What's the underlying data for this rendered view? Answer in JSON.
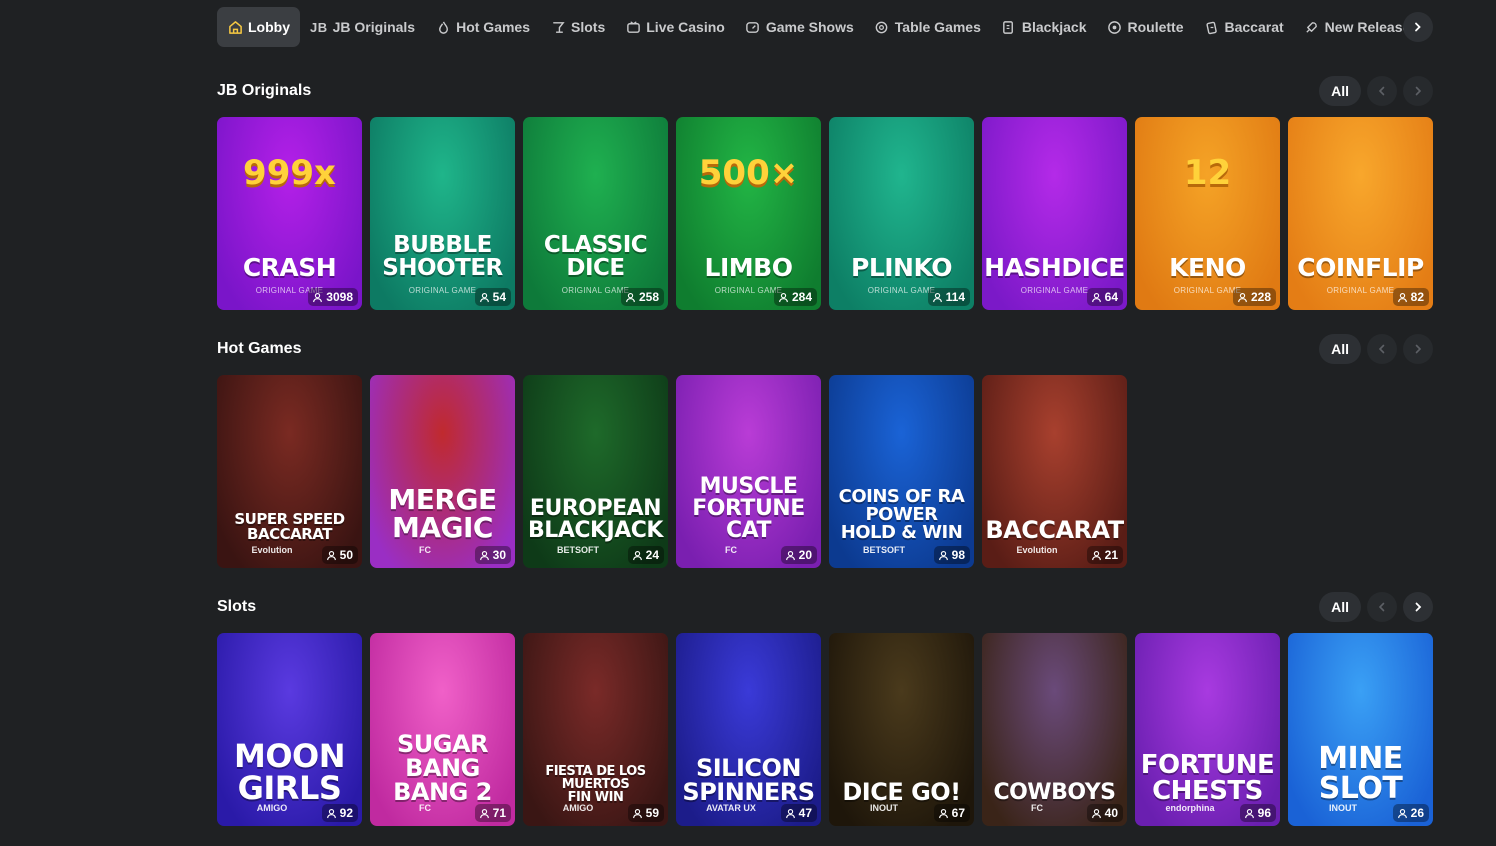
{
  "nav": {
    "items": [
      {
        "label": "Lobby",
        "icon": "home-icon",
        "active": true
      },
      {
        "label": "JB Originals",
        "icon": "jb-logo-icon",
        "prefix": "JB"
      },
      {
        "label": "Hot Games",
        "icon": "flame-icon"
      },
      {
        "label": "Slots",
        "icon": "cocktail-icon"
      },
      {
        "label": "Live Casino",
        "icon": "tv-icon"
      },
      {
        "label": "Game Shows",
        "icon": "gauge-icon"
      },
      {
        "label": "Table Games",
        "icon": "chip-stack-icon"
      },
      {
        "label": "Blackjack",
        "icon": "cards-icon"
      },
      {
        "label": "Roulette",
        "icon": "roulette-icon"
      },
      {
        "label": "Baccarat",
        "icon": "card-fan-icon"
      },
      {
        "label": "New Releases",
        "icon": "rocket-icon"
      }
    ],
    "next_icon": "chevron-right-icon"
  },
  "sections": {
    "originals": {
      "title": "JB Originals",
      "all_label": "All",
      "games": [
        {
          "title": "CRASH",
          "sub": "ORIGINAL GAME",
          "players": "3098",
          "bg1": "#b420e8",
          "bg2": "#7a15c9",
          "badge": "999x"
        },
        {
          "title": "BUBBLE\nSHOOTER",
          "sub": "ORIGINAL GAME",
          "players": "54",
          "bg1": "#1fb58a",
          "bg2": "#0d7a63"
        },
        {
          "title": "CLASSIC\nDICE",
          "sub": "ORIGINAL GAME",
          "players": "258",
          "bg1": "#1fb050",
          "bg2": "#0e7a3a"
        },
        {
          "title": "LIMBO",
          "sub": "ORIGINAL GAME",
          "players": "284",
          "bg1": "#22b545",
          "bg2": "#0f7d2f",
          "badge": "500×"
        },
        {
          "title": "PLINKO",
          "sub": "ORIGINAL GAME",
          "players": "114",
          "bg1": "#20b58e",
          "bg2": "#0d7f65"
        },
        {
          "title": "HASHDICE",
          "sub": "ORIGINAL GAME",
          "players": "64",
          "bg1": "#b42ae8",
          "bg2": "#7b19c8"
        },
        {
          "title": "KENO",
          "sub": "ORIGINAL GAME",
          "players": "228",
          "bg1": "#f5a326",
          "bg2": "#e07a13",
          "badge": "12"
        },
        {
          "title": "COINFLIP",
          "sub": "ORIGINAL GAME",
          "players": "82",
          "bg1": "#f8a72c",
          "bg2": "#e47d15"
        }
      ]
    },
    "hot": {
      "title": "Hot Games",
      "all_label": "All",
      "games": [
        {
          "title": "SUPER SPEED\nBACCARAT",
          "prov": "Evolution",
          "players": "50",
          "bg1": "#7a2a22",
          "bg2": "#3a1412",
          "size": 15
        },
        {
          "title": "MERGE\nMAGIC",
          "prov": "FC",
          "players": "30",
          "bg1": "#c02a2e",
          "bg2": "#9a2ec4",
          "size": 28
        },
        {
          "title": "EUROPEAN\nBLACKJACK",
          "prov": "BETSOFT",
          "players": "24",
          "bg1": "#1e6a2a",
          "bg2": "#0e3a18",
          "size": 22
        },
        {
          "title": "MUSCLE\nFORTUNE CAT",
          "prov": "FC",
          "players": "20",
          "bg1": "#b93cd6",
          "bg2": "#7a1fb0",
          "size": 22
        },
        {
          "title": "COINS OF RA\nPOWER\nHOLD & WIN",
          "prov": "BETSOFT",
          "players": "98",
          "bg1": "#1a63d6",
          "bg2": "#0c3a90",
          "size": 18
        },
        {
          "title": "BACCARAT",
          "prov": "Evolution",
          "players": "21",
          "bg1": "#a8402e",
          "bg2": "#5a1d16",
          "size": 24
        }
      ]
    },
    "slots": {
      "title": "Slots",
      "all_label": "All",
      "games": [
        {
          "title": "MOON\nGIRLS",
          "prov": "AMIGO",
          "players": "92",
          "bg1": "#5a3ae0",
          "bg2": "#2a1aa8",
          "size": 32
        },
        {
          "title": "SUGAR\nBANG BANG 2",
          "prov": "FC",
          "players": "71",
          "bg1": "#f060c8",
          "bg2": "#c02aa0",
          "size": 24
        },
        {
          "title": "FIESTA DE LOS MUERTOS\nFIN WIN",
          "prov": "AMIGO",
          "players": "59",
          "bg1": "#7a2a28",
          "bg2": "#3a1614",
          "size": 13
        },
        {
          "title": "SILICON\nSPINNERS",
          "prov": "AVATAR UX",
          "players": "47",
          "bg1": "#3a3ad8",
          "bg2": "#1c1c8a",
          "size": 24
        },
        {
          "title": "DICE GO!",
          "prov": "INOUT",
          "players": "67",
          "bg1": "#4a3a1c",
          "bg2": "#1e160a",
          "size": 24
        },
        {
          "title": "COWBOYS",
          "prov": "FC",
          "players": "40",
          "bg1": "#6a4a7a",
          "bg2": "#3a2418",
          "size": 22
        },
        {
          "title": "FORTUNE\nCHESTS",
          "prov": "endorphina",
          "players": "96",
          "bg1": "#a83ae0",
          "bg2": "#6a1fb0",
          "size": 26
        },
        {
          "title": "MINE\nSLOT",
          "prov": "INOUT",
          "players": "26",
          "bg1": "#3aa0f5",
          "bg2": "#1a62d6",
          "size": 30
        }
      ]
    }
  }
}
